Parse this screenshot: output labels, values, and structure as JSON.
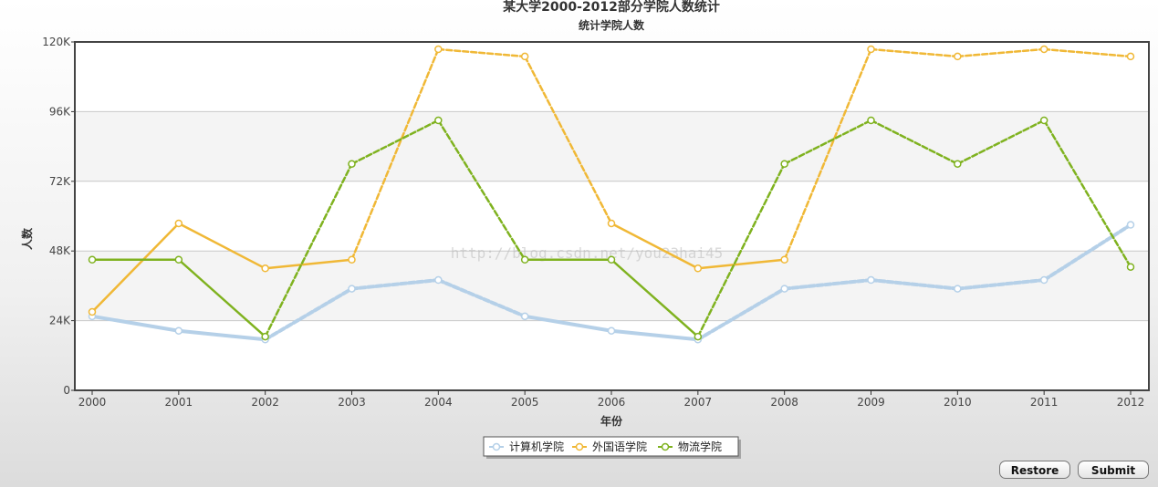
{
  "chart_data": {
    "type": "line",
    "title": "某大学2000-2012部分学院人数统计",
    "subtitle": "统计学院人数",
    "xlabel": "年份",
    "ylabel": "人数",
    "ylim": [
      0,
      120000
    ],
    "y_ticks": [
      0,
      24000,
      48000,
      72000,
      96000,
      120000
    ],
    "y_tick_labels": [
      "0",
      "24K",
      "48K",
      "72K",
      "96K",
      "120K"
    ],
    "categories": [
      "2000",
      "2001",
      "2002",
      "2003",
      "2004",
      "2005",
      "2006",
      "2007",
      "2008",
      "2009",
      "2010",
      "2011",
      "2012"
    ],
    "grid": "horizontal, alternating bands",
    "legend_position": "bottom-center",
    "watermark": "http://blog.csdn.net/you23hai45",
    "series": [
      {
        "name": "计算机学院",
        "color": "#b5d0e8",
        "values": [
          25500,
          20500,
          17500,
          35000,
          38000,
          25500,
          20500,
          17500,
          35000,
          38000,
          35000,
          38000,
          57000
        ]
      },
      {
        "name": "外国语学院",
        "color": "#f0b836",
        "values": [
          27000,
          57500,
          42000,
          45000,
          117500,
          115000,
          57500,
          42000,
          45000,
          117500,
          115000,
          117500,
          115000
        ]
      },
      {
        "name": "物流学院",
        "color": "#7fb21f",
        "values": [
          45000,
          45000,
          18500,
          78000,
          93000,
          45000,
          45000,
          18500,
          78000,
          93000,
          78000,
          93000,
          42500
        ]
      }
    ]
  },
  "buttons": {
    "restore": "Restore",
    "submit": "Submit"
  }
}
